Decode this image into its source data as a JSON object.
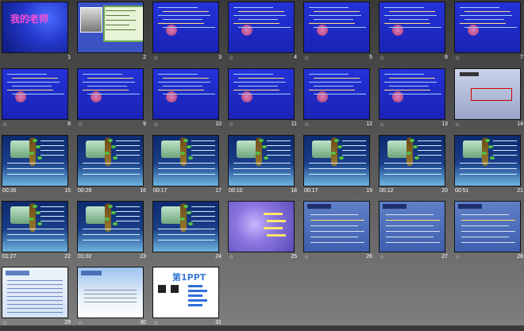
{
  "slides": [
    {
      "n": "1",
      "variant": "title",
      "title": "我的老师",
      "time": "",
      "icon": ""
    },
    {
      "n": "2",
      "variant": "portrait",
      "time": "",
      "icon": ""
    },
    {
      "n": "3",
      "variant": "blue",
      "time": "",
      "icon": "☆"
    },
    {
      "n": "4",
      "variant": "blue",
      "time": "",
      "icon": "☆"
    },
    {
      "n": "5",
      "variant": "blue",
      "time": "",
      "icon": "☆"
    },
    {
      "n": "6",
      "variant": "blue",
      "time": "",
      "icon": "☆"
    },
    {
      "n": "7",
      "variant": "blue",
      "time": "",
      "icon": "☆"
    },
    {
      "n": "8",
      "variant": "blue",
      "time": "",
      "icon": "☆"
    },
    {
      "n": "9",
      "variant": "blue",
      "time": "",
      "icon": "☆"
    },
    {
      "n": "10",
      "variant": "blue",
      "time": "",
      "icon": "☆"
    },
    {
      "n": "11",
      "variant": "blue",
      "time": "",
      "icon": "☆"
    },
    {
      "n": "12",
      "variant": "blue",
      "time": "",
      "icon": "☆"
    },
    {
      "n": "13",
      "variant": "blue",
      "time": "",
      "icon": "☆"
    },
    {
      "n": "14",
      "variant": "winter",
      "time": "",
      "icon": "☆"
    },
    {
      "n": "15",
      "variant": "nature",
      "time": "00:35",
      "icon": ""
    },
    {
      "n": "16",
      "variant": "nature",
      "time": "00:26",
      "icon": ""
    },
    {
      "n": "17",
      "variant": "nature",
      "time": "00:17",
      "icon": ""
    },
    {
      "n": "18",
      "variant": "nature",
      "time": "00:10",
      "icon": ""
    },
    {
      "n": "19",
      "variant": "nature",
      "time": "00:17",
      "icon": ""
    },
    {
      "n": "20",
      "variant": "nature",
      "time": "00:12",
      "icon": ""
    },
    {
      "n": "21",
      "variant": "nature",
      "time": "00:51",
      "icon": ""
    },
    {
      "n": "22",
      "variant": "nature",
      "time": "01:27",
      "icon": ""
    },
    {
      "n": "23",
      "variant": "nature",
      "time": "01:02",
      "icon": ""
    },
    {
      "n": "24",
      "variant": "nature",
      "time": "",
      "icon": ""
    },
    {
      "n": "25",
      "variant": "purple",
      "time": "",
      "icon": "☆"
    },
    {
      "n": "26",
      "variant": "rain",
      "time": "",
      "icon": "☆"
    },
    {
      "n": "27",
      "variant": "rain",
      "time": "",
      "icon": "☆"
    },
    {
      "n": "28",
      "variant": "rain",
      "time": "",
      "icon": "☆"
    },
    {
      "n": "29",
      "variant": "white",
      "time": "",
      "icon": "☆"
    },
    {
      "n": "30",
      "variant": "sky",
      "time": "",
      "icon": "☆"
    },
    {
      "n": "31",
      "variant": "ppt",
      "title": "第1PPT",
      "time": "",
      "icon": "☆"
    }
  ],
  "colors": {
    "background": "#555555",
    "slideTitlePink": "#ff4fd8",
    "slideBlue": "#1f2bd0"
  }
}
